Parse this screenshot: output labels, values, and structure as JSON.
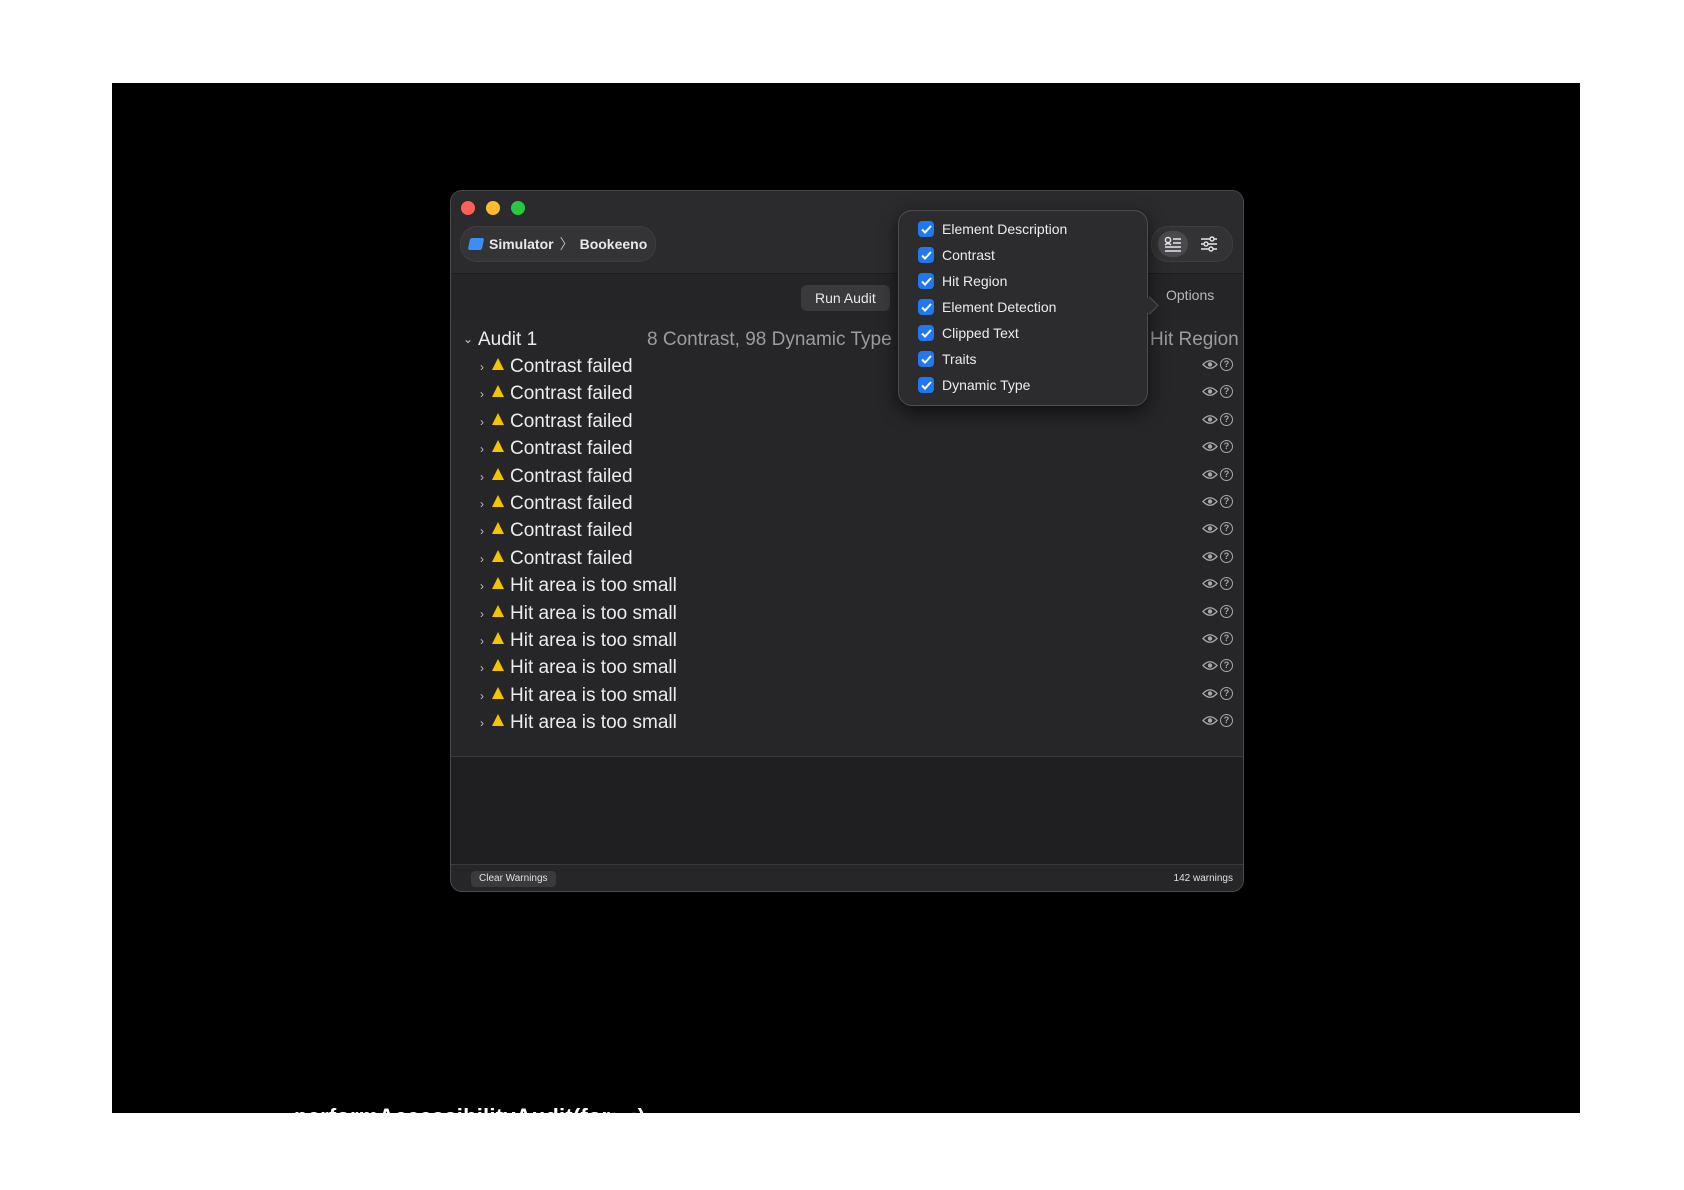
{
  "window": {
    "scheme": {
      "destination": "Simulator",
      "app": "Bookeeno"
    },
    "toolbar": {
      "run_audit_label": "Run Audit",
      "options_label": "Options"
    },
    "audit": {
      "title": "Audit 1",
      "summary": "8 Contrast, 98 Dynamic Type",
      "summary_right": "Hit Region",
      "issues": [
        {
          "label": "Contrast failed"
        },
        {
          "label": "Contrast failed"
        },
        {
          "label": "Contrast failed"
        },
        {
          "label": "Contrast failed"
        },
        {
          "label": "Contrast failed"
        },
        {
          "label": "Contrast failed"
        },
        {
          "label": "Contrast failed"
        },
        {
          "label": "Contrast failed"
        },
        {
          "label": "Hit area is too small"
        },
        {
          "label": "Hit area is too small"
        },
        {
          "label": "Hit area is too small"
        },
        {
          "label": "Hit area is too small"
        },
        {
          "label": "Hit area is too small"
        },
        {
          "label": "Hit area is too small"
        }
      ]
    },
    "footer": {
      "clear_label": "Clear Warnings",
      "count_label": "142 warnings"
    }
  },
  "options_popover": {
    "items": [
      {
        "label": "Element Description",
        "checked": true
      },
      {
        "label": "Contrast",
        "checked": true
      },
      {
        "label": "Hit Region",
        "checked": true
      },
      {
        "label": "Element Detection",
        "checked": true
      },
      {
        "label": "Clipped Text",
        "checked": true
      },
      {
        "label": "Traits",
        "checked": true
      },
      {
        "label": "Dynamic Type",
        "checked": true
      }
    ]
  },
  "caption": "performAccessibilityAudit(for:_:)",
  "colors": {
    "accent": "#1f78f2",
    "warning": "#f5c400",
    "close": "#fe5f57",
    "minimize": "#febc2e",
    "zoom": "#28c840"
  }
}
